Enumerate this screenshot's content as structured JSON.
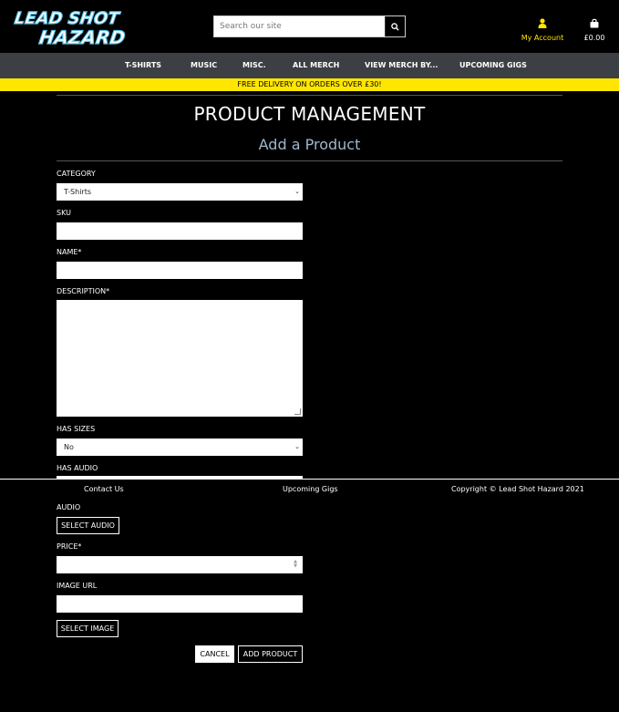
{
  "header": {
    "logo": {
      "line1": "LEAD SHOT",
      "line2": "HAZARD"
    },
    "search_placeholder": "Search our site",
    "account_label": "My Account",
    "bag_total": "£0.00"
  },
  "nav": {
    "items": [
      "T-SHIRTS",
      "MUSIC",
      "MISC.",
      "ALL MERCH",
      "VIEW MERCH BY...",
      "UPCOMING GIGS"
    ]
  },
  "banner": "FREE DELIVERY ON ORDERS OVER £30!",
  "page": {
    "title": "PRODUCT MANAGEMENT",
    "subtitle": "Add a Product"
  },
  "form": {
    "category_label": "CATEGORY",
    "category_value": "T-Shirts",
    "sku_label": "SKU",
    "name_label": "NAME*",
    "description_label": "DESCRIPTION*",
    "has_sizes_label": "HAS SIZES",
    "has_sizes_value": "No",
    "has_audio_label": "HAS AUDIO",
    "audio_label": "AUDIO",
    "select_audio": "SELECT AUDIO",
    "price_label": "PRICE*",
    "image_url_label": "IMAGE URL",
    "select_image": "SELECT IMAGE",
    "cancel": "CANCEL",
    "add_product": "ADD PRODUCT"
  },
  "footer": {
    "contact": "Contact Us",
    "gigs": "Upcoming Gigs",
    "copyright": "Copyright © Lead Shot Hazard 2021"
  },
  "colors": {
    "accent": "#ffe600",
    "nav_bg": "#3c3f43",
    "subtitle": "#9fb7cc"
  }
}
